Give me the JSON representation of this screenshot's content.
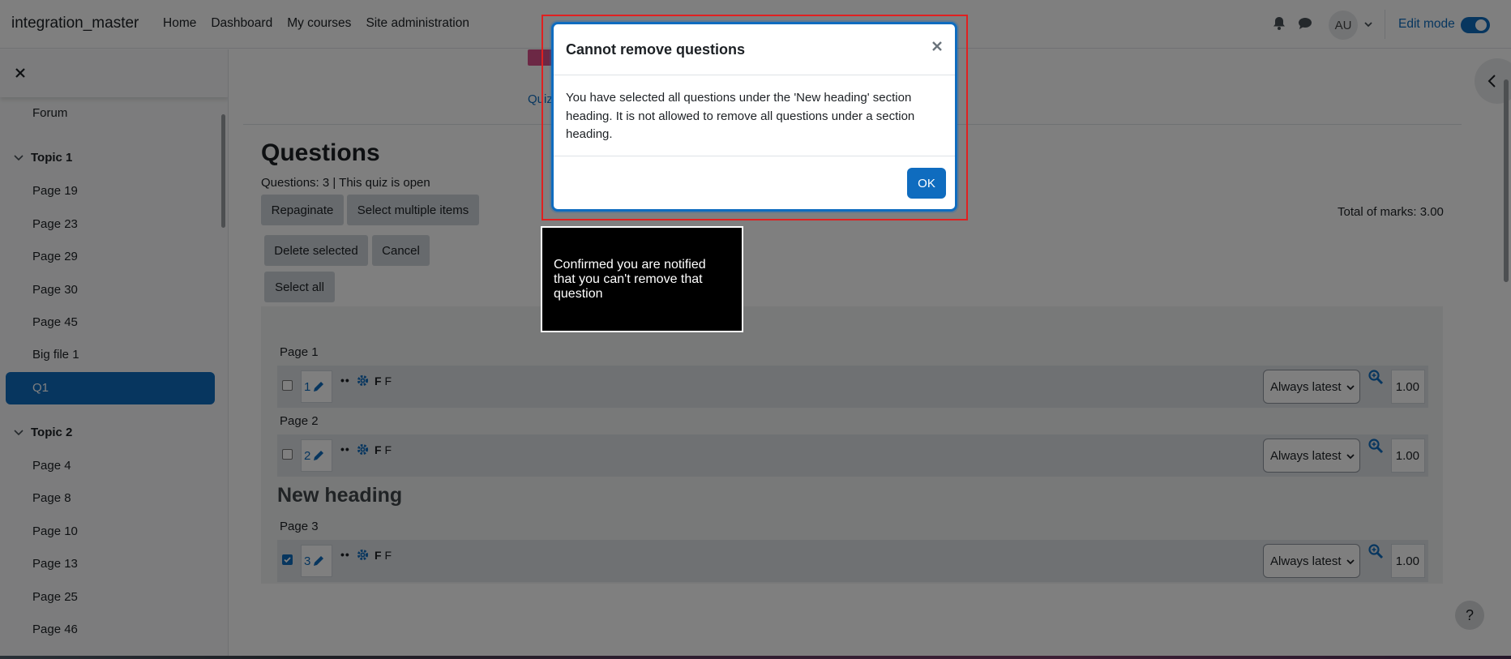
{
  "navbar": {
    "brand": "integration_master",
    "links": [
      "Home",
      "Dashboard",
      "My courses",
      "Site administration"
    ],
    "avatar_initials": "AU",
    "edit_mode_label": "Edit mode",
    "icons": [
      "bell-icon",
      "chat-icon",
      "chevron-down-icon"
    ]
  },
  "drawer": {
    "items": [
      {
        "type": "item",
        "label": "Forum"
      },
      {
        "type": "topic",
        "label": "Topic 1"
      },
      {
        "type": "item",
        "label": "Page 19"
      },
      {
        "type": "item",
        "label": "Page 23"
      },
      {
        "type": "item",
        "label": "Page 29"
      },
      {
        "type": "item",
        "label": "Page 30"
      },
      {
        "type": "item",
        "label": "Page 45"
      },
      {
        "type": "item",
        "label": "Big file 1"
      },
      {
        "type": "active",
        "label": "Q1"
      },
      {
        "type": "topic",
        "label": "Topic 2"
      },
      {
        "type": "item",
        "label": "Page 4"
      },
      {
        "type": "item",
        "label": "Page 8"
      },
      {
        "type": "item",
        "label": "Page 10"
      },
      {
        "type": "item",
        "label": "Page 13"
      },
      {
        "type": "item",
        "label": "Page 25"
      },
      {
        "type": "item",
        "label": "Page 46"
      }
    ]
  },
  "main": {
    "quiz_tab": "Quiz",
    "title": "Questions",
    "status": "Questions: 3 | This quiz is open",
    "repaginate": "Repaginate",
    "select_multiple": "Select multiple items",
    "delete_selected": "Delete selected",
    "cancel": "Cancel",
    "select_all": "Select all",
    "total_marks": "Total of marks: 3.00",
    "new_heading": "New heading",
    "pages": [
      "Page 1",
      "Page 2",
      "Page 3"
    ],
    "questions": [
      {
        "num": "1",
        "name_bold": "F",
        "name": "F",
        "version": "Always latest",
        "mark": "1.00",
        "checked": false
      },
      {
        "num": "2",
        "name_bold": "F",
        "name": "F",
        "version": "Always latest",
        "mark": "1.00",
        "checked": false
      },
      {
        "num": "3",
        "name_bold": "F",
        "name": "F",
        "version": "Always latest",
        "mark": "1.00",
        "checked": true
      }
    ],
    "help": "?"
  },
  "modal": {
    "title": "Cannot remove questions",
    "body": "You have selected all questions under the 'New heading' section heading. It is not allowed to remove all questions under a section heading.",
    "ok": "OK"
  },
  "callout": "Confirmed you are notified that you can't remove that question",
  "colors": {
    "accent": "#0f6cbf",
    "highlight": "#e02020"
  }
}
